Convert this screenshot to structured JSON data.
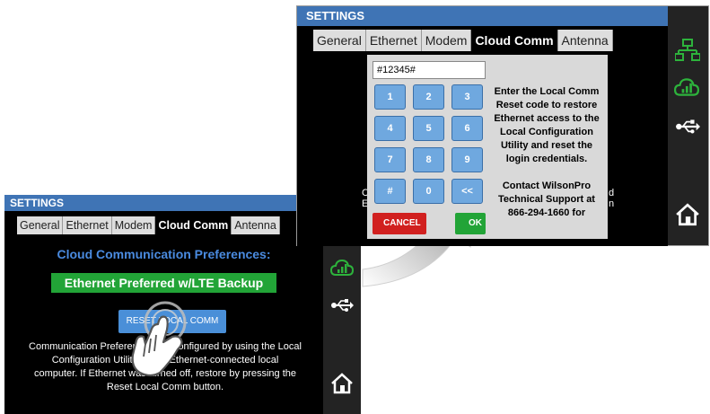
{
  "small_panel": {
    "title": "SETTINGS",
    "tabs": [
      "General",
      "Ethernet",
      "Modem",
      "Cloud Comm",
      "Antenna"
    ],
    "active_tab": "Cloud Comm",
    "heading": "Cloud Communication Preferences:",
    "preference_value": "Ethernet Preferred w/LTE Backup",
    "reset_button_label": "RESET LOCAL COMM",
    "description_lines": [
      "Communication Preferences are configured by using the Local",
      "Configuration Utility via an Ethernet-connected local",
      "computer. If Ethernet was turned off, restore by pressing the",
      "Reset Local Comm button."
    ],
    "sidebar_icons": [
      "cloud-signal-icon",
      "usb-icon",
      "home-icon"
    ]
  },
  "big_panel": {
    "title": "SETTINGS",
    "tabs": [
      "General",
      "Ethernet",
      "Modem",
      "Cloud Comm",
      "Antenna"
    ],
    "active_tab": "Cloud Comm",
    "behind_left": "C",
    "behind_left2": "E",
    "behind_right": "d",
    "behind_right2": "n",
    "sidebar_icons": [
      "network-icon",
      "cloud-signal-icon",
      "usb-icon",
      "home-icon"
    ],
    "dialog": {
      "code_value": "#12345#",
      "keys": [
        "1",
        "2",
        "3",
        "4",
        "5",
        "6",
        "7",
        "8",
        "9",
        "#",
        "0",
        "<<"
      ],
      "cancel_label": "CANCEL",
      "ok_label": "OK",
      "instructions_lines": [
        "Enter the Local Comm",
        "Reset code to restore",
        "Ethernet access to the",
        "Local Configuration",
        "Utility and reset the",
        "login credentials."
      ],
      "support_lines": [
        "Contact WilsonPro",
        "Technical Support at",
        "866-294-1660 for"
      ]
    }
  },
  "colors": {
    "title_bar": "#3f74b5",
    "accent_blue": "#4a8be0",
    "green": "#22a437",
    "red": "#d1201f",
    "key_blue": "#6fa8df"
  }
}
